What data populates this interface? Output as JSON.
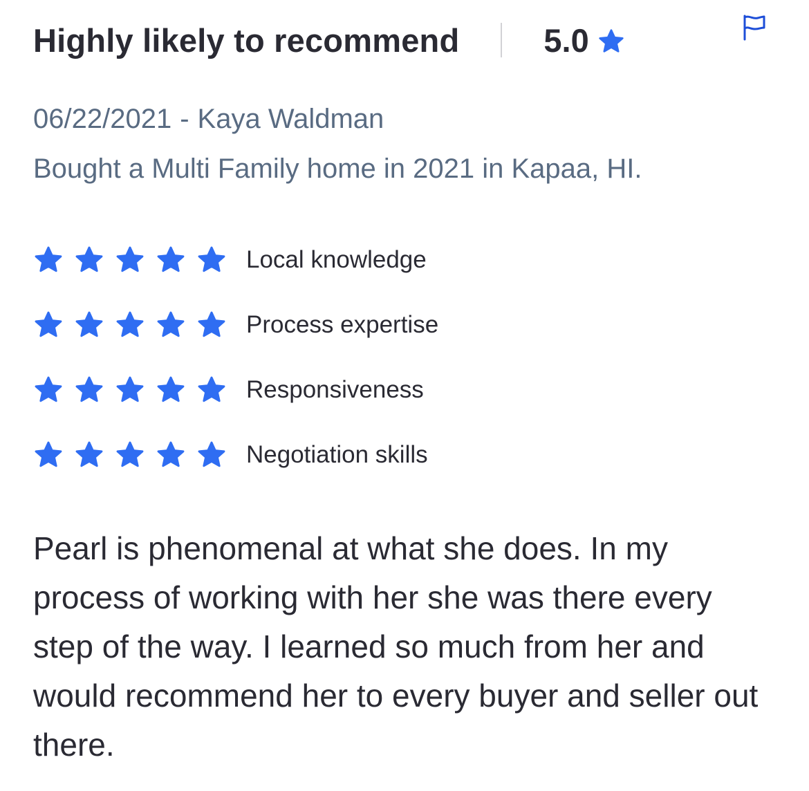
{
  "review": {
    "headline": "Highly likely to recommend",
    "score": "5.0",
    "date": "06/22/2021",
    "separator": "-",
    "author": "Kaya Waldman",
    "transaction": "Bought a Multi Family home in 2021 in Kapaa, HI.",
    "ratings": [
      {
        "label": "Local knowledge",
        "stars": 5
      },
      {
        "label": "Process expertise",
        "stars": 5
      },
      {
        "label": "Responsiveness",
        "stars": 5
      },
      {
        "label": "Negotiation skills",
        "stars": 5
      }
    ],
    "body": "Pearl is phenomenal at what she does. In my process of working with her she was there every step of the way. I learned so much from her and would recommend her to every buyer and seller out there."
  },
  "icons": {
    "star": "star-icon",
    "report": "flag-icon"
  },
  "colors": {
    "accent": "#2f6df2",
    "heading": "#2a2a33",
    "meta": "#596b82",
    "divider": "#d1d1d5",
    "flag": "#1d4ed8"
  }
}
